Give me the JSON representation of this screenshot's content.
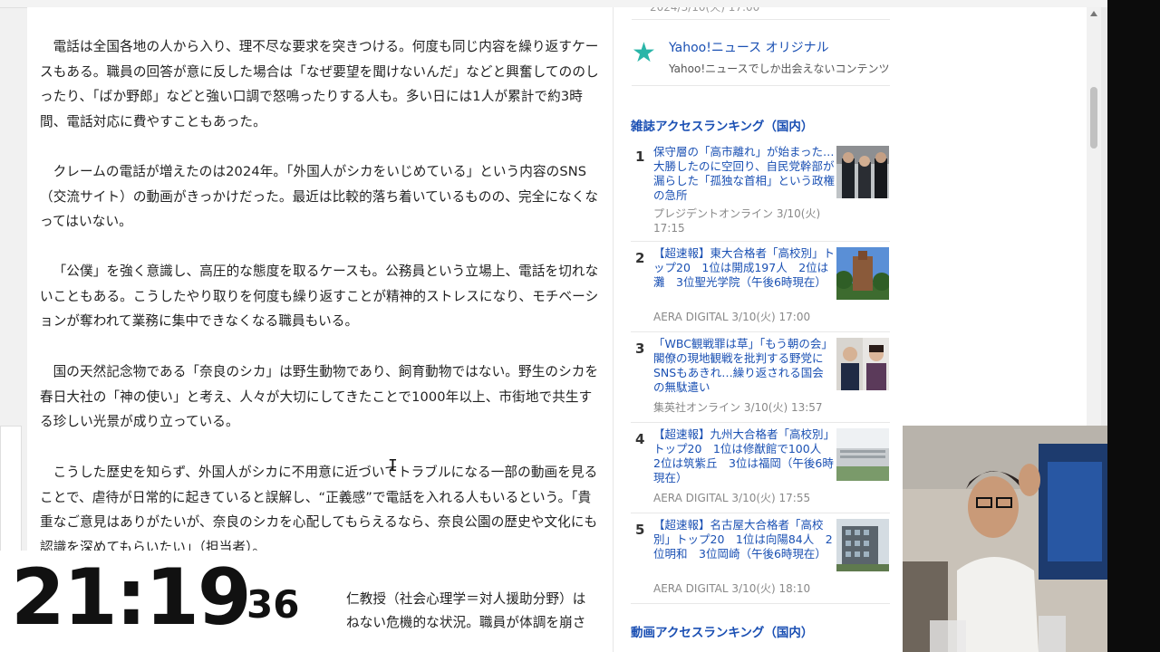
{
  "article": {
    "paragraphs": [
      "電話は全国各地の人から入り、理不尽な要求を突きつける。何度も同じ内容を繰り返すケースもある。職員の回答が意に反した場合は「なぜ要望を聞けないんだ」などと興奮してののしったり、「ばか野郎」などと強い口調で怒鳴ったりする人も。多い日には1人が累計で約3時間、電話対応に費やすこともあった。",
      "クレームの電話が増えたのは2024年。「外国人がシカをいじめている」という内容のSNS（交流サイト）の動画がきっかけだった。最近は比較的落ち着いているものの、完全になくなってはいない。",
      "「公僕」を強く意識し、高圧的な態度を取るケースも。公務員という立場上、電話を切れないこともある。こうしたやり取りを何度も繰り返すことが精神的ストレスになり、モチベーションが奪われて業務に集中できなくなる職員もいる。",
      "国の天然記念物である「奈良のシカ」は野生動物であり、飼育動物ではない。野生のシカを春日大社の「神の使い」と考え、人々が大切にしてきたことで1000年以上、市街地で共生する珍しい光景が成り立っている。",
      "こうした歴史を知らず、外国人がシカに不用意に近づいてトラブルになる一部の動画を見ることで、虐待が日常的に起きていると誤解し、“正義感”で電話を入れる人もいるという。「貴重なご意見はありがたいが、奈良のシカを心配してもらえるなら、奈良公園の歴史や文化にも認識を深めてもらいたい」（担当者）。",
      "仁教授（社会心理学＝対人援助分野）は",
      "ねない危機的な状況。職員が体調を崩さ"
    ]
  },
  "sidebar": {
    "top_partial": "2024/3/10(火) 17:00",
    "yahoo_original": {
      "title": "Yahoo!ニュース オリジナル",
      "subtitle": "Yahoo!ニュースでしか出会えないコンテンツ"
    },
    "magazine_ranking": {
      "title": "雑誌アクセスランキング（国内）",
      "items": [
        {
          "rank": "1",
          "headline": "保守層の「高市離れ」が始まった…大勝したのに空回り、自民党幹部が漏らした「孤独な首相」という政権の急所",
          "source": "プレジデントオンライン 3/10(火) 17:15"
        },
        {
          "rank": "2",
          "headline": "【超速報】東大合格者「高校別」トップ20　1位は開成197人　2位は灘　3位聖光学院（午後6時現在）",
          "source": "AERA DIGITAL 3/10(火) 17:00"
        },
        {
          "rank": "3",
          "headline": "「WBC観戦罪は草」「もう朝の会」閣僚の現地観戦を批判する野党にSNSもあきれ…繰り返される国会の無駄遣い",
          "source": "集英社オンライン 3/10(火) 13:57"
        },
        {
          "rank": "4",
          "headline": "【超速報】九州大合格者「高校別」トップ20　1位は修猷館で100人　2位は筑紫丘　3位は福岡（午後6時現在）",
          "source": "AERA DIGITAL 3/10(火) 17:55"
        },
        {
          "rank": "5",
          "headline": "【超速報】名古屋大合格者「高校別」トップ20　1位は向陽84人　2位明和　3位岡崎（午後6時現在）",
          "source": "AERA DIGITAL 3/10(火) 18:10"
        }
      ]
    },
    "video_ranking": {
      "title": "動画アクセスランキング（国内）"
    }
  },
  "overlay": {
    "clock_main": "21:19",
    "clock_seconds": "36"
  }
}
